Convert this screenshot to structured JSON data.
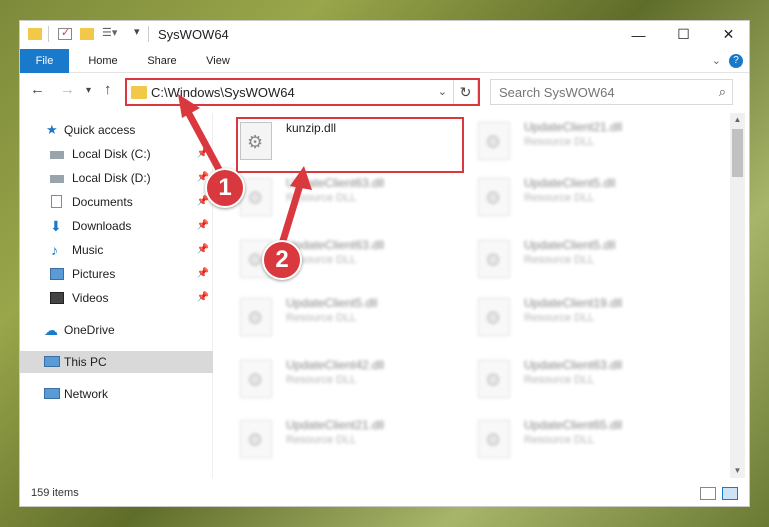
{
  "window": {
    "title": "SysWOW64"
  },
  "ribbon": {
    "tabs": [
      "File",
      "Home",
      "Share",
      "View"
    ],
    "help": "?"
  },
  "address": {
    "path": "C:\\Windows\\SysWOW64",
    "search_placeholder": "Search SysWOW64"
  },
  "sidebar": {
    "items": [
      {
        "label": "Quick access"
      },
      {
        "label": "Local Disk (C:)"
      },
      {
        "label": "Local Disk (D:)"
      },
      {
        "label": "Documents"
      },
      {
        "label": "Downloads"
      },
      {
        "label": "Music"
      },
      {
        "label": "Pictures"
      },
      {
        "label": "Videos"
      },
      {
        "label": "OneDrive"
      },
      {
        "label": "This PC"
      },
      {
        "label": "Network"
      }
    ]
  },
  "files": {
    "highlighted": {
      "name": "kunzip.dll"
    },
    "left": [
      {
        "name": "UpdateClient63.dll",
        "type": "Resource DLL"
      },
      {
        "name": "UpdateClient63.dll",
        "type": "Resource DLL"
      },
      {
        "name": "UpdateClient5.dll",
        "type": "Resource DLL"
      },
      {
        "name": "UpdateClient42.dll",
        "type": "Resource DLL"
      },
      {
        "name": "UpdateClient21.dll",
        "type": "Resource DLL"
      }
    ],
    "right": [
      {
        "name": "UpdateClient21.dll",
        "type": "Resource DLL"
      },
      {
        "name": "UpdateClient5.dll",
        "type": "Resource DLL"
      },
      {
        "name": "UpdateClient5.dll",
        "type": "Resource DLL"
      },
      {
        "name": "UpdateClient19.dll",
        "type": "Resource DLL"
      },
      {
        "name": "UpdateClient63.dll",
        "type": "Resource DLL"
      },
      {
        "name": "UpdateClient65.dll",
        "type": "Resource DLL"
      }
    ]
  },
  "status": {
    "item_count": "159 items"
  },
  "callouts": {
    "one": "1",
    "two": "2"
  },
  "colors": {
    "accent": "#1979ca",
    "highlight": "#d9383f",
    "folder": "#f2c84b"
  }
}
